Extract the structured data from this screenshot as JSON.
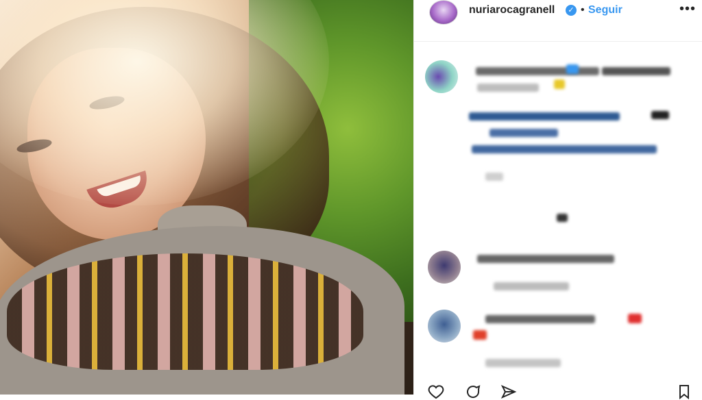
{
  "post": {
    "username": "nuriarocagranell",
    "follow_label": "Seguir",
    "separator": "•",
    "more_label": "•••",
    "verified_mark": "✓"
  },
  "icons": {
    "like": "heart-icon",
    "comment": "comment-icon",
    "share": "paper-plane-icon",
    "save": "bookmark-icon"
  },
  "colors": {
    "accent": "#3897f0",
    "text": "#262626",
    "divider": "#efefef"
  }
}
